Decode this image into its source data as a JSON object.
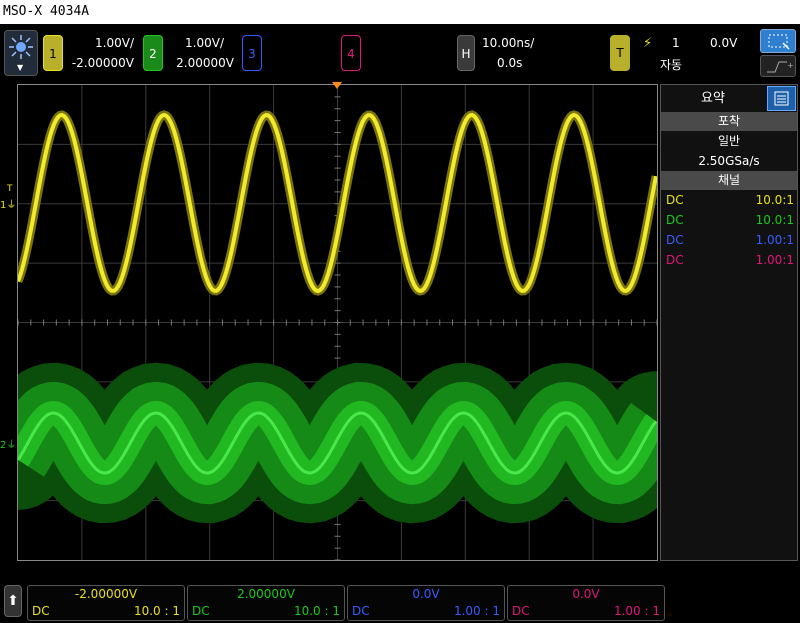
{
  "window": {
    "title": "MSO-X 4034A"
  },
  "channels": [
    {
      "number": "1",
      "scale": "1.00V/",
      "offset": "-2.00000V",
      "color": "#e8e020",
      "coupling": "DC",
      "probe_side": "10.0:1",
      "probe_bottom": "10.0 : 1"
    },
    {
      "number": "2",
      "scale": "1.00V/",
      "offset": "2.00000V",
      "color": "#1cc91c",
      "coupling": "DC",
      "probe_side": "10.0:1",
      "probe_bottom": "10.0 : 1"
    },
    {
      "number": "3",
      "scale": "",
      "offset": "0.0V",
      "color": "#3a5cff",
      "coupling": "DC",
      "probe_side": "1.00:1",
      "probe_bottom": "1.00 : 1"
    },
    {
      "number": "4",
      "scale": "",
      "offset": "0.0V",
      "color": "#e0187a",
      "coupling": "DC",
      "probe_side": "1.00:1",
      "probe_bottom": "1.00 : 1"
    }
  ],
  "horizontal": {
    "label": "H",
    "timebase": "10.00ns/",
    "delay": "0.0s"
  },
  "trigger": {
    "label": "T",
    "source": "1",
    "level": "0.0V",
    "mode": "자동"
  },
  "side_panel": {
    "tab_summary": "요약",
    "acquisition_header": "포착",
    "acquisition_mode": "일반",
    "sample_rate": "2.50GSa/s",
    "channels_header": "채널"
  },
  "markers": {
    "ch1": "1",
    "ch2": "2",
    "trig": "T"
  },
  "colors": {
    "accent_blue": "#3a86d8",
    "panel": "#111111"
  }
}
